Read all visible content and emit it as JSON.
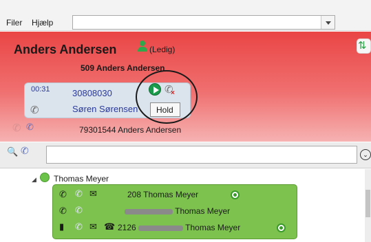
{
  "menu": {
    "items": [
      "Filer",
      "Hjælp"
    ],
    "address_value": ""
  },
  "header": {
    "user_name": "Anders Andersen",
    "status": "(Ledig)",
    "extension_title": "509 Anders Andersen",
    "colors": {
      "busy_red": "#ea4545",
      "available_green": "#7dc24e"
    }
  },
  "active_call": {
    "duration": "00:31",
    "number": "30808030",
    "contact": "Søren Sørensen",
    "actions": {
      "resume_icon": "play-icon",
      "hangup_icon": "hangup-icon"
    },
    "tooltip": "Hold"
  },
  "held_call": {
    "text": "79301544 Anders Andersen"
  },
  "search": {
    "value": ""
  },
  "contacts": {
    "group_name": "Thomas Meyer",
    "extensions": [
      {
        "text": "208 Thomas Meyer",
        "redacted": false
      },
      {
        "prefix": "",
        "text": "Thomas Meyer",
        "redacted": true
      },
      {
        "prefix": "2126",
        "text": "Thomas Meyer",
        "redacted": true
      }
    ]
  }
}
